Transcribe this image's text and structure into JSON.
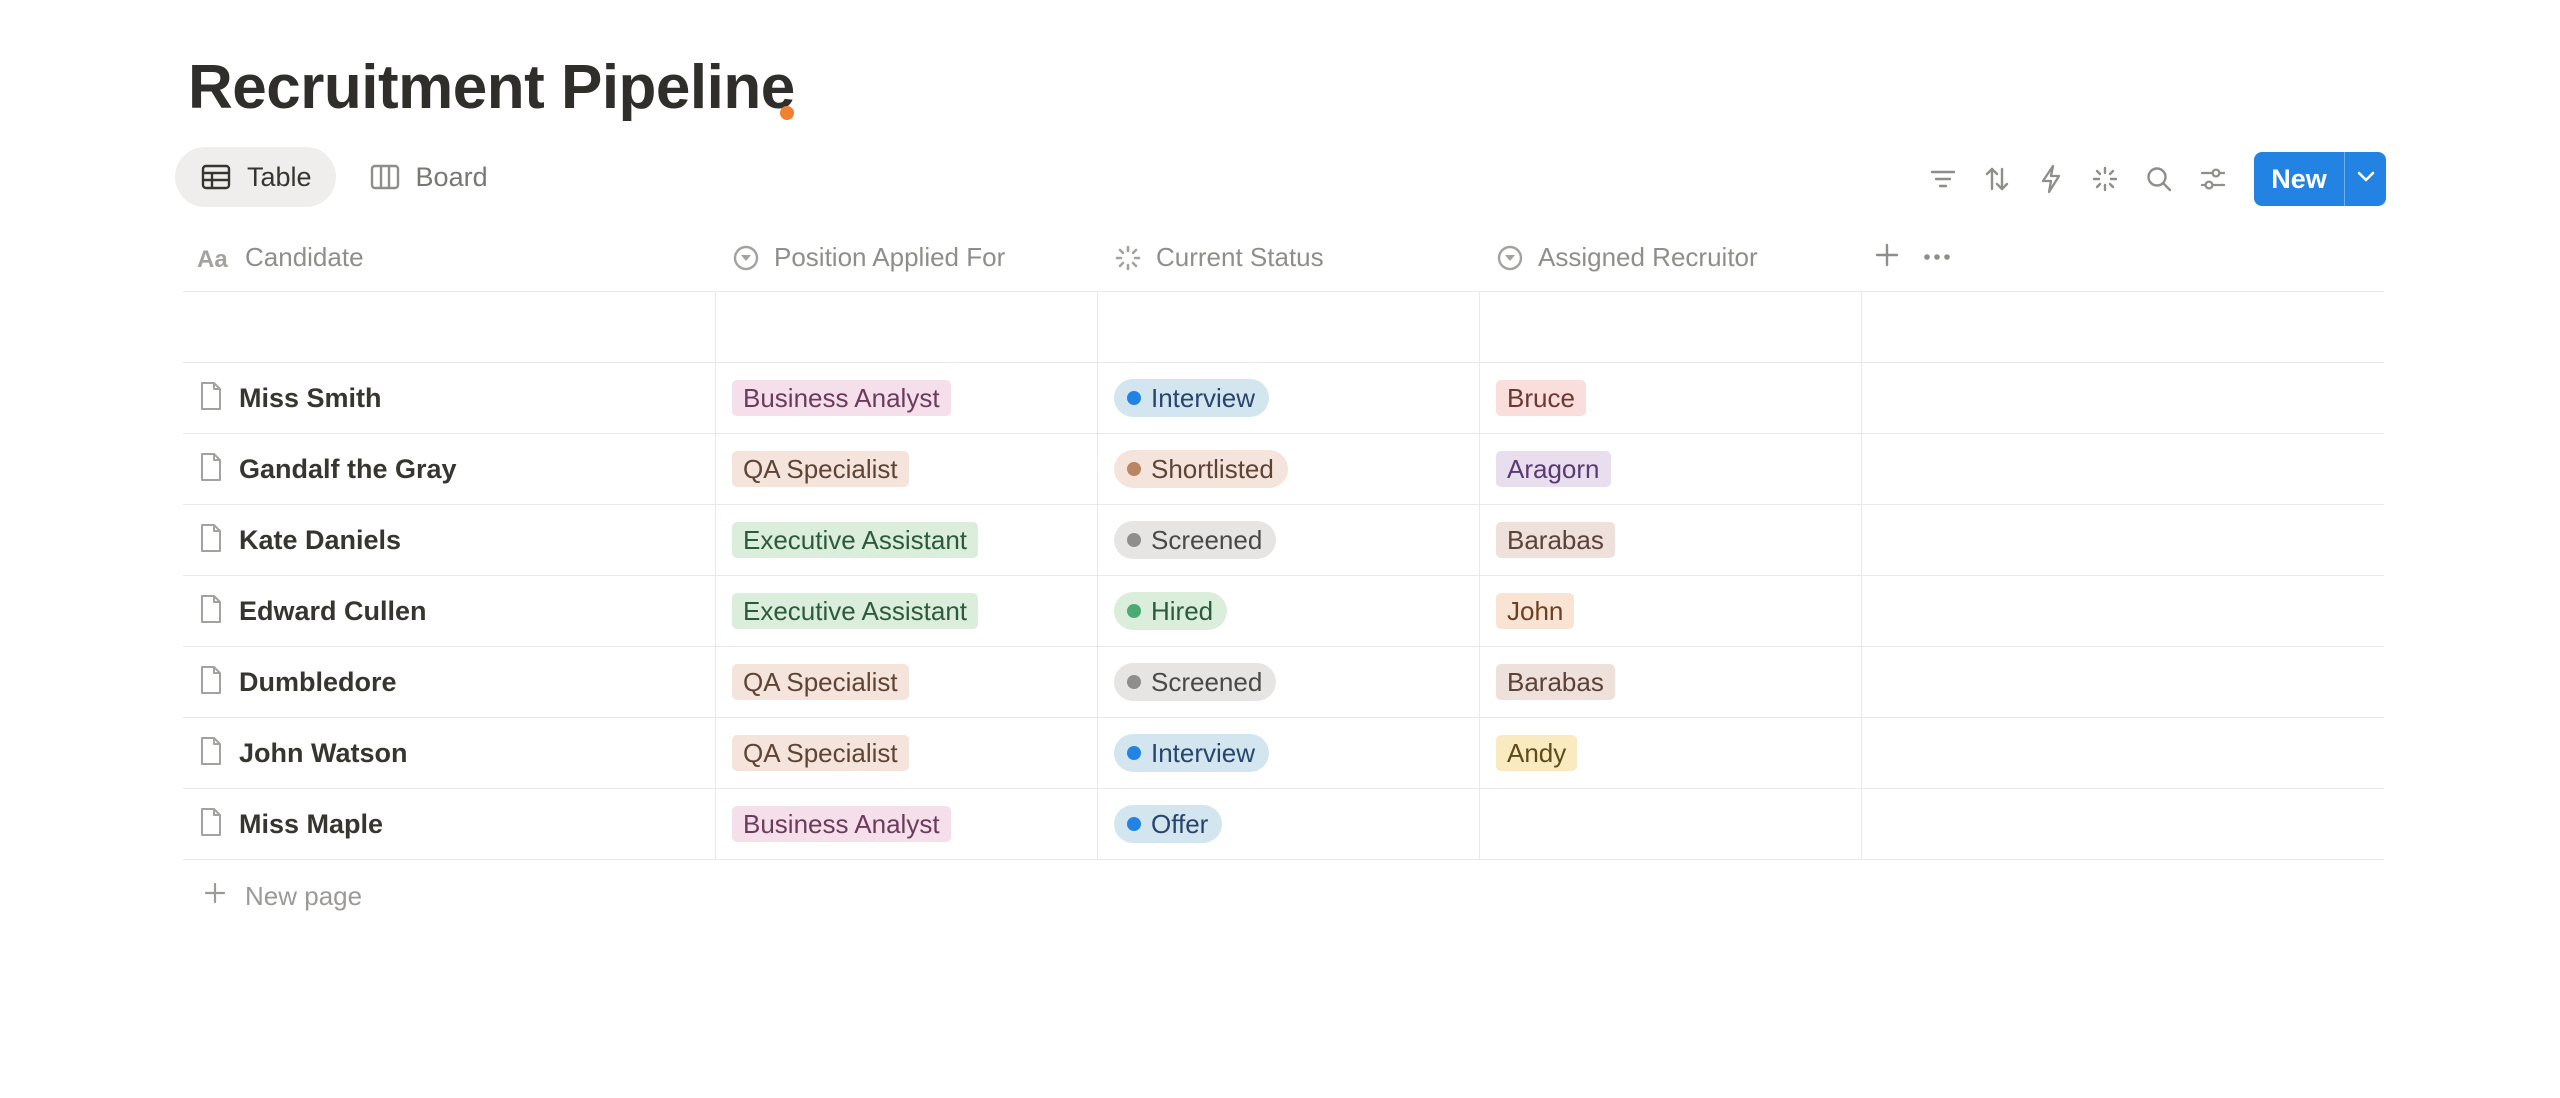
{
  "page": {
    "title": "Recruitment Pipeline"
  },
  "views": [
    {
      "label": "Table",
      "icon": "table-icon",
      "active": true
    },
    {
      "label": "Board",
      "icon": "board-icon",
      "active": false
    }
  ],
  "toolbar": {
    "icons": [
      "filter-icon",
      "sort-icon",
      "automation-icon",
      "ai-sparkle-icon",
      "search-icon",
      "settings-sliders-icon"
    ],
    "new_label": "New"
  },
  "table": {
    "columns": [
      {
        "label": "Candidate",
        "icon": "text-property-icon"
      },
      {
        "label": "Position Applied For",
        "icon": "select-property-icon"
      },
      {
        "label": "Current Status",
        "icon": "status-property-icon"
      },
      {
        "label": "Assigned Recruitor",
        "icon": "select-property-icon"
      }
    ],
    "rows": [
      {
        "candidate": "",
        "position": "",
        "status": "",
        "recruiter": ""
      },
      {
        "candidate": "Miss Smith",
        "position": "Business Analyst",
        "status": "Interview",
        "recruiter": "Bruce"
      },
      {
        "candidate": "Gandalf the Gray",
        "position": "QA Specialist",
        "status": "Shortlisted",
        "recruiter": "Aragorn"
      },
      {
        "candidate": "Kate Daniels",
        "position": "Executive Assistant",
        "status": "Screened",
        "recruiter": "Barabas"
      },
      {
        "candidate": "Edward Cullen",
        "position": "Executive Assistant",
        "status": "Hired",
        "recruiter": "John"
      },
      {
        "candidate": "Dumbledore",
        "position": "QA Specialist",
        "status": "Screened",
        "recruiter": "Barabas"
      },
      {
        "candidate": "John Watson",
        "position": "QA Specialist",
        "status": "Interview",
        "recruiter": "Andy"
      },
      {
        "candidate": "Miss Maple",
        "position": "Business Analyst",
        "status": "Offer",
        "recruiter": ""
      }
    ],
    "new_page_label": "New page"
  },
  "colors": {
    "accent": "#2383e2",
    "title_dot": "#f08133",
    "position_tags": {
      "Business Analyst": {
        "bg": "#f4dfeb",
        "fg": "#6c3b5c"
      },
      "QA Specialist": {
        "bg": "#f4e4dc",
        "fg": "#5f4436"
      },
      "Executive Assistant": {
        "bg": "#dbeddb",
        "fg": "#2c5b3c"
      }
    },
    "status_tags": {
      "Interview": {
        "bg": "#d3e5ef",
        "fg": "#28456c",
        "dot": "#2383e2"
      },
      "Offer": {
        "bg": "#d3e5ef",
        "fg": "#28456c",
        "dot": "#2383e2"
      },
      "Shortlisted": {
        "bg": "#f4e4dc",
        "fg": "#5f4436",
        "dot": "#b98563"
      },
      "Screened": {
        "bg": "#e6e5e3",
        "fg": "#4a4945",
        "dot": "#8f8e8a"
      },
      "Hired": {
        "bg": "#dbeddb",
        "fg": "#2c5b3c",
        "dot": "#4caa72"
      }
    },
    "recruiter_tags": {
      "Bruce": {
        "bg": "#fadedc",
        "fg": "#6e3630"
      },
      "Aragorn": {
        "bg": "#e8deee",
        "fg": "#5a3a72"
      },
      "Barabas": {
        "bg": "#eee0da",
        "fg": "#5c4237"
      },
      "John": {
        "bg": "#f9e3d3",
        "fg": "#6b3f22"
      },
      "Andy": {
        "bg": "#f9eabf",
        "fg": "#5e4a1a"
      }
    }
  }
}
